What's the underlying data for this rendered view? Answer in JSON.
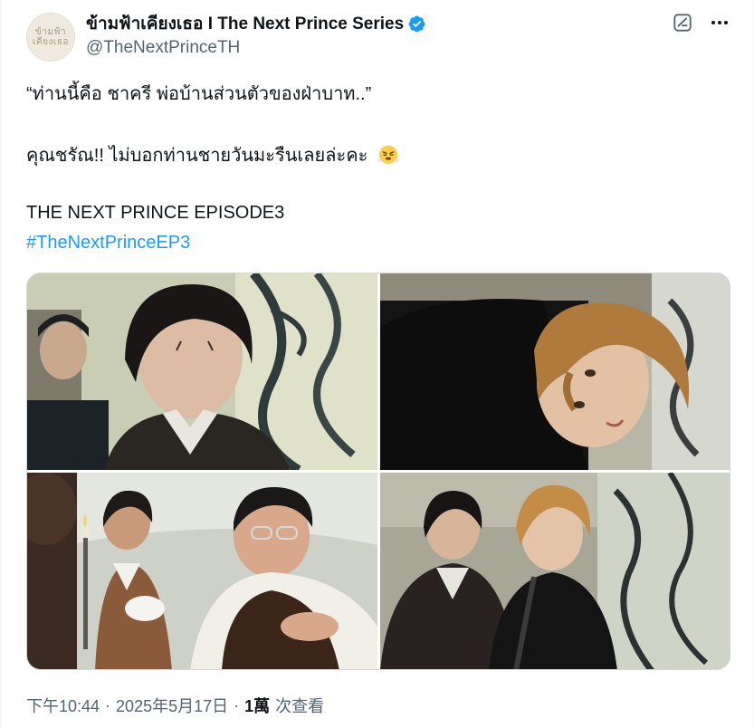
{
  "author": {
    "display_name": "ข้ามฟ้าเคียงเธอ I The Next Prince Series",
    "handle": "@TheNextPrinceTH",
    "verified": true,
    "avatar_logo_text": [
      "ข้ามฟ้า",
      "เคียงเธอ"
    ]
  },
  "tweet": {
    "line1": "“ท่านนี้คือ ชาครี พ่อบ้านส่วนตัวของฝ่าบาท..”",
    "line2": "คุณชรัณ!! ไม่บอกท่านชายวันมะรืนเลยล่ะคะ",
    "line2_emoji": "face-with-steam-icon",
    "line3": "THE NEXT PRINCE EPISODE3",
    "hashtag": "#TheNextPrinceEP3"
  },
  "media": {
    "photos": [
      {
        "name": "photo-1",
        "description_icon": "image"
      },
      {
        "name": "photo-2",
        "description_icon": "image"
      },
      {
        "name": "photo-3",
        "description_icon": "image"
      },
      {
        "name": "photo-4",
        "description_icon": "image"
      }
    ]
  },
  "meta": {
    "time": "下午10:44",
    "separator": "·",
    "date": "2025年5月17日",
    "views_count": "1萬",
    "views_label": "次查看"
  },
  "colors": {
    "link": "#1d9bf0",
    "secondary_text": "#536471",
    "primary_text": "#0f1419",
    "verified_badge": "#1d9bf0"
  }
}
